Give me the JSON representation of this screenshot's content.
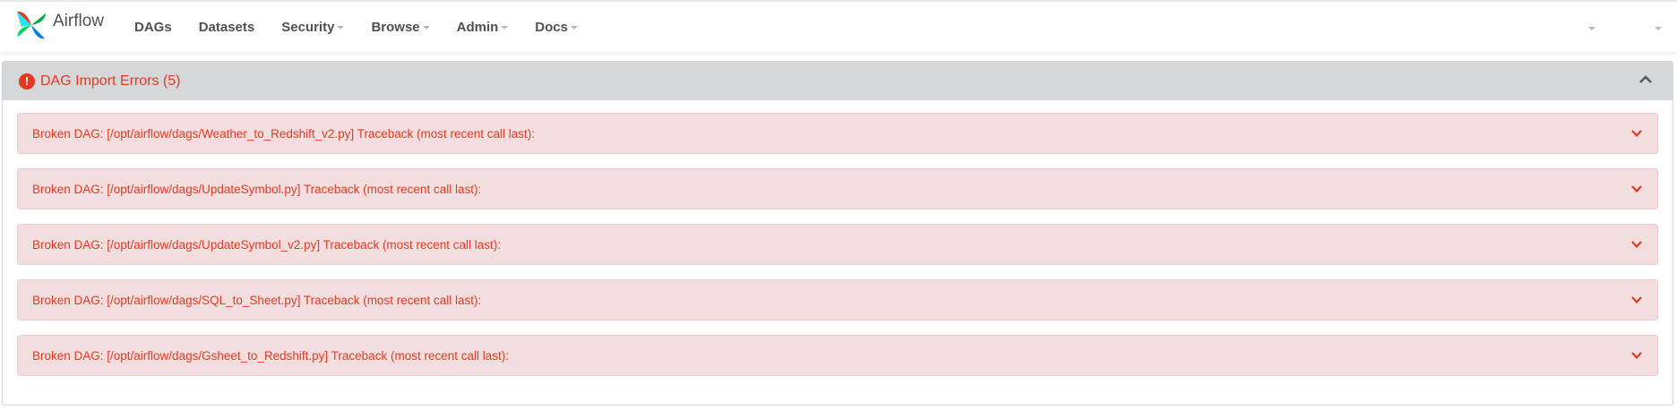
{
  "brand": {
    "name": "Airflow"
  },
  "nav": [
    {
      "label": "DAGs",
      "dropdown": false
    },
    {
      "label": "Datasets",
      "dropdown": false
    },
    {
      "label": "Security",
      "dropdown": true
    },
    {
      "label": "Browse",
      "dropdown": true
    },
    {
      "label": "Admin",
      "dropdown": true
    },
    {
      "label": "Docs",
      "dropdown": true
    }
  ],
  "panel": {
    "title": "DAG Import Errors (5)",
    "icon": "exclamation-circle-icon",
    "accent_color": "#e43921"
  },
  "errors": [
    "Broken DAG: [/opt/airflow/dags/Weather_to_Redshift_v2.py] Traceback (most recent call last):",
    "Broken DAG: [/opt/airflow/dags/UpdateSymbol.py] Traceback (most recent call last):",
    "Broken DAG: [/opt/airflow/dags/UpdateSymbol_v2.py] Traceback (most recent call last):",
    "Broken DAG: [/opt/airflow/dags/SQL_to_Sheet.py] Traceback (most recent call last):",
    "Broken DAG: [/opt/airflow/dags/Gsheet_to_Redshift.py] Traceback (most recent call last):"
  ]
}
